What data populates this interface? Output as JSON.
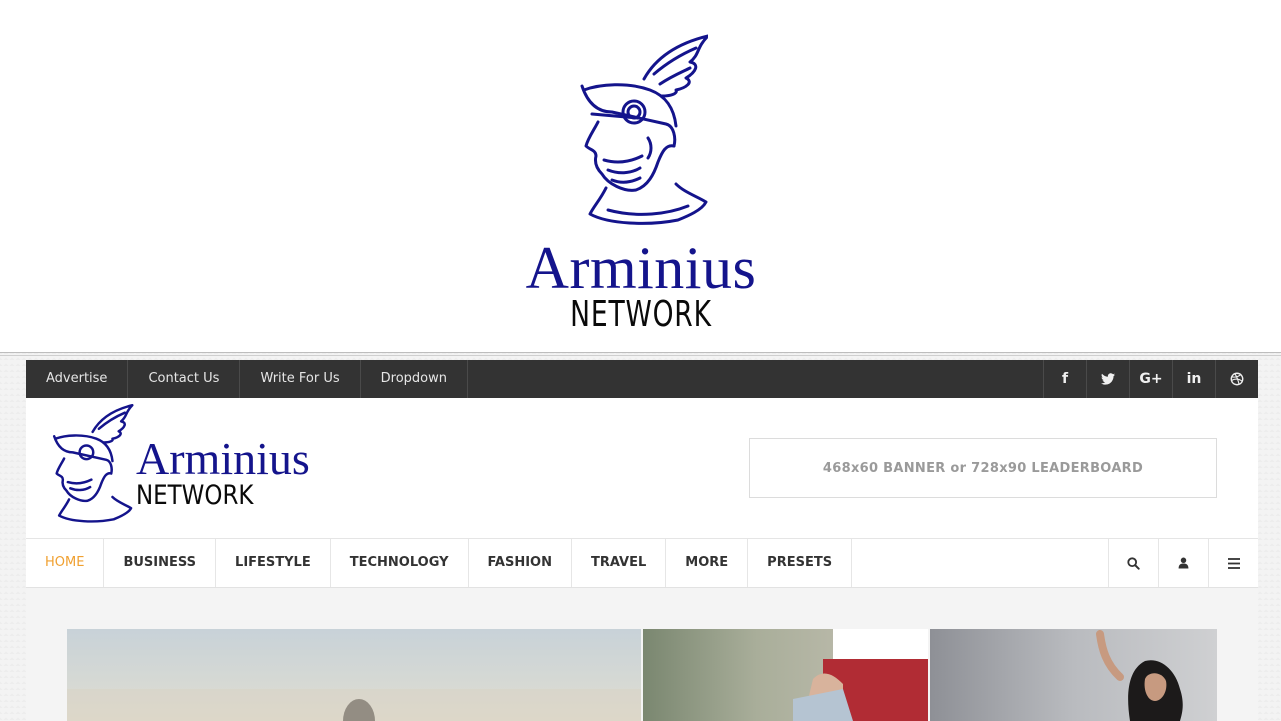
{
  "brand": {
    "name_line1": "Arminius",
    "name_line2": "NETWORK",
    "color": "#14148c"
  },
  "topbar": {
    "links": [
      "Advertise",
      "Contact Us",
      "Write For Us",
      "Dropdown"
    ],
    "social": [
      {
        "icon": "facebook-icon",
        "glyph": "f"
      },
      {
        "icon": "twitter-icon",
        "glyph": ""
      },
      {
        "icon": "google-plus-icon",
        "glyph": "G+"
      },
      {
        "icon": "linkedin-icon",
        "glyph": "in"
      },
      {
        "icon": "dribbble-icon",
        "glyph": ""
      }
    ]
  },
  "header": {
    "ad_text": "468x60 BANNER or 728x90 LEADERBOARD"
  },
  "nav": {
    "items": [
      "HOME",
      "BUSINESS",
      "LIFESTYLE",
      "TECHNOLOGY",
      "FASHION",
      "TRAVEL",
      "MORE",
      "PRESETS"
    ],
    "active": "HOME",
    "active_color": "#f0a030",
    "icons": [
      "search-icon",
      "user-icon",
      "menu-icon"
    ]
  }
}
